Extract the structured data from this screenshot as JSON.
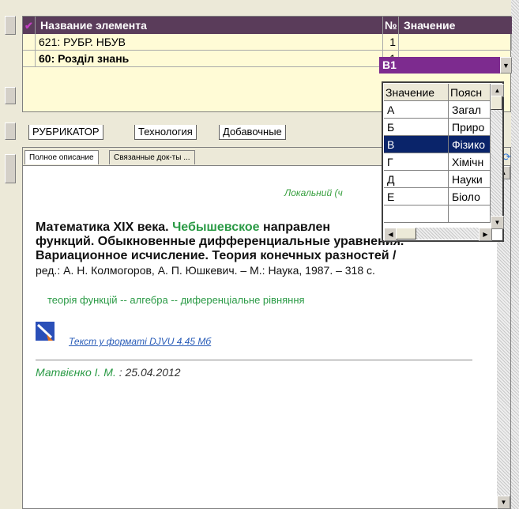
{
  "grid": {
    "columns": [
      {
        "label": "Название элемента"
      },
      {
        "label": "№"
      },
      {
        "label": "Значение"
      }
    ],
    "rows": [
      {
        "name": "621: РУБР. НБУВ",
        "num": "1",
        "value": ""
      },
      {
        "name": "60: Розділ знань",
        "num": "1",
        "value": "В1"
      }
    ]
  },
  "dropdown": {
    "headers": [
      "Значение",
      "Поясн"
    ],
    "rows": [
      {
        "code": "А",
        "desc": "Загал"
      },
      {
        "code": "Б",
        "desc": "Приро"
      },
      {
        "code": "В",
        "desc": "Фізико",
        "selected": true
      },
      {
        "code": "Г",
        "desc": "Хімічн"
      },
      {
        "code": "Д",
        "desc": "Науки"
      },
      {
        "code": "Е",
        "desc": "Біоло"
      }
    ]
  },
  "tabs": [
    "РУБРИКАТОР",
    "Технология",
    "Добавочные"
  ],
  "subtabs": [
    "Полное описание",
    "Связанные док-ты ..."
  ],
  "content": {
    "local_tag": "Локальний (ч",
    "title_part1": "Математика XIX века.",
    "title_green": "Чебышевское",
    "title_part2": "направлен",
    "title_line2": "функций. Обыкновенные дифференциальные уравнения.",
    "title_line3": "Вариационное исчисление. Теория конечных разностей /",
    "title_line4": "ред.: А. Н. Колмогоров, А. П. Юшкевич. – М.: Наука, 1987. – 318 с.",
    "subjects": "теорія функцій -- алгебра -- диференціальне рівняння",
    "file_link": "Текст у форматі DJVU 4.45 Мб",
    "author": "Матвієнко І. М.",
    "author_date": ": 25.04.2012"
  },
  "colors": {
    "header_bg": "#5a3c5a",
    "combo_bg": "#7d2b8f",
    "selection": "#0a246a",
    "accent_green": "#2a9a45",
    "link": "#2a5db8",
    "grid_bg": "#fffbd6"
  }
}
